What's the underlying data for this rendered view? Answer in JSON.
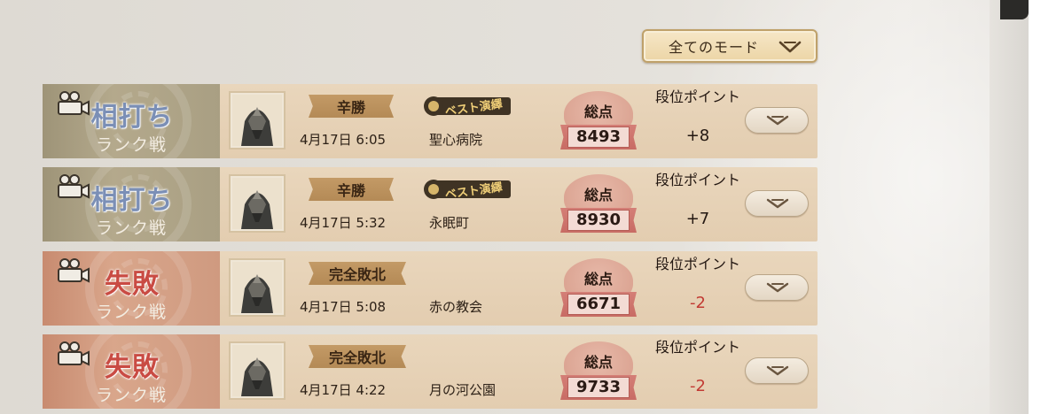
{
  "mode_filter": {
    "label": "全てのモード",
    "icon": "chevron-down-icon"
  },
  "matches": [
    {
      "result": "相打ち",
      "result_type": "draw",
      "mode": "ランク戦",
      "outcome": "辛勝",
      "best_badge": "ベスト演繹",
      "date": "4月17日 6:05",
      "map": "聖心病院",
      "score_label": "総点",
      "score": "8493",
      "rank_label": "段位ポイント",
      "rank_points": "+8"
    },
    {
      "result": "相打ち",
      "result_type": "draw",
      "mode": "ランク戦",
      "outcome": "辛勝",
      "best_badge": "ベスト演繹",
      "date": "4月17日 5:32",
      "map": "永眠町",
      "score_label": "総点",
      "score": "8930",
      "rank_label": "段位ポイント",
      "rank_points": "+7"
    },
    {
      "result": "失敗",
      "result_type": "lose",
      "mode": "ランク戦",
      "outcome": "完全敗北",
      "best_badge": "",
      "date": "4月17日 5:08",
      "map": "赤の教会",
      "score_label": "総点",
      "score": "6671",
      "rank_label": "段位ポイント",
      "rank_points": "-2"
    },
    {
      "result": "失敗",
      "result_type": "lose",
      "mode": "ランク戦",
      "outcome": "完全敗北",
      "best_badge": "",
      "date": "4月17日 4:22",
      "map": "月の河公園",
      "score_label": "総点",
      "score": "9733",
      "rank_label": "段位ポイント",
      "rank_points": "-2"
    }
  ]
}
